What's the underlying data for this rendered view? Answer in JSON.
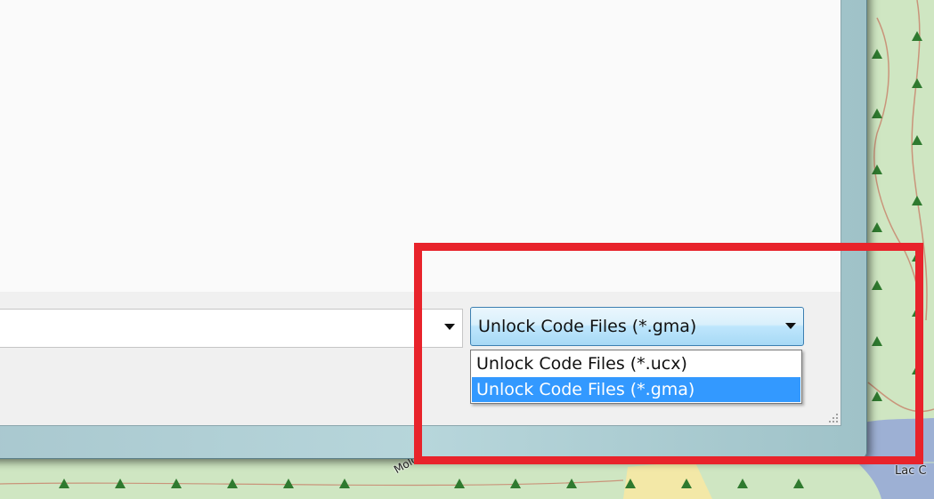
{
  "filename_field": {
    "value": ""
  },
  "filetype_select": {
    "selected": "Unlock Code Files (*.gma)"
  },
  "dropdown": {
    "options": [
      "Unlock Code Files (*.ucx)",
      "Unlock Code Files (*.gma)"
    ],
    "selected_index": 1
  },
  "map": {
    "labels": [
      "Molone",
      "Lac C"
    ]
  },
  "colors": {
    "highlight": "#e8232b",
    "selection": "#3399ff",
    "map_green": "#cfe6c2",
    "water": "#9db0d4"
  },
  "icons": [
    "tree-icon",
    "dropdown-arrow-icon",
    "resize-grip-icon"
  ]
}
